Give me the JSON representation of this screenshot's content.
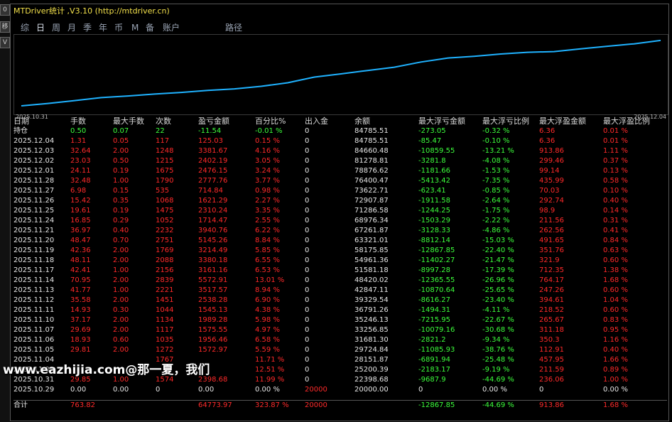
{
  "window": {
    "title": "MTDriver统计 ,V3.10 (http://mtdriver.cn)"
  },
  "left_strip": {
    "btn1": "0",
    "btn2": "移",
    "btn3": "V"
  },
  "tabs": [
    "综",
    "日",
    "周",
    "月",
    "季",
    "年",
    "币",
    "M",
    "备",
    "账户",
    "路径"
  ],
  "active_tab": "日",
  "chart": {
    "start_date": "2025.10.31",
    "end_date": "2025.12.04",
    "line_color": "#1fb2ff"
  },
  "chart_data": {
    "type": "line",
    "x": [
      "2025.10.31",
      "2025.11.03",
      "2025.11.04",
      "2025.11.05",
      "2025.11.06",
      "2025.11.07",
      "2025.11.10",
      "2025.11.11",
      "2025.11.12",
      "2025.11.13",
      "2025.11.14",
      "2025.11.17",
      "2025.11.18",
      "2025.11.19",
      "2025.11.20",
      "2025.11.21",
      "2025.11.24",
      "2025.11.25",
      "2025.11.26",
      "2025.11.27",
      "2025.11.28",
      "2025.12.01",
      "2025.12.02",
      "2025.12.03",
      "2025.12.04"
    ],
    "y": [
      20000,
      22398.68,
      25200.39,
      28151.87,
      29724.84,
      31681.3,
      33256.85,
      35246.13,
      36791.26,
      39329.54,
      42847.11,
      48420.02,
      51581.18,
      54961.36,
      58175.85,
      63321.01,
      67261.87,
      68976.34,
      71286.58,
      72907.87,
      73622.71,
      76400.47,
      78876.62,
      81278.81,
      84660.48
    ]
  },
  "headers": [
    "日期",
    "手数",
    "最大手数",
    "次数",
    "盈亏金额",
    "百分比%",
    "出入金",
    "余额",
    "最大浮亏金额",
    "最大浮亏比例",
    "最大浮盈金额",
    "最大浮盈比例"
  ],
  "holding": [
    "持仓",
    "0.50",
    "0.07",
    "22",
    "-11.54",
    "-0.01 %",
    "0",
    "84785.51",
    "-273.05",
    "-0.32 %",
    "6.36",
    "0.01 %"
  ],
  "rows": [
    [
      "2025.12.04",
      "1.31",
      "0.05",
      "117",
      "125.03",
      "0.15 %",
      "0",
      "84785.51",
      "-85.47",
      "-0.10 %",
      "6.36",
      "0.01 %"
    ],
    [
      "2025.12.03",
      "32.64",
      "2.00",
      "1248",
      "3381.67",
      "4.16 %",
      "0",
      "84660.48",
      "-10859.55",
      "-13.21 %",
      "913.86",
      "1.11 %"
    ],
    [
      "2025.12.02",
      "23.03",
      "0.50",
      "1215",
      "2402.19",
      "3.05 %",
      "0",
      "81278.81",
      "-3281.8",
      "-4.08 %",
      "299.46",
      "0.37 %"
    ],
    [
      "2025.12.01",
      "24.11",
      "0.19",
      "1675",
      "2476.15",
      "3.24 %",
      "0",
      "78876.62",
      "-1181.66",
      "-1.53 %",
      "99.14",
      "0.13 %"
    ],
    [
      "2025.11.28",
      "32.48",
      "1.00",
      "1790",
      "2777.76",
      "3.77 %",
      "0",
      "76400.47",
      "-5413.42",
      "-7.35 %",
      "435.99",
      "0.58 %"
    ],
    [
      "2025.11.27",
      "6.98",
      "0.15",
      "535",
      "714.84",
      "0.98 %",
      "0",
      "73622.71",
      "-623.41",
      "-0.85 %",
      "70.03",
      "0.10 %"
    ],
    [
      "2025.11.26",
      "15.42",
      "0.35",
      "1068",
      "1621.29",
      "2.27 %",
      "0",
      "72907.87",
      "-1911.58",
      "-2.64 %",
      "292.74",
      "0.40 %"
    ],
    [
      "2025.11.25",
      "19.61",
      "0.19",
      "1475",
      "2310.24",
      "3.35 %",
      "0",
      "71286.58",
      "-1244.25",
      "-1.75 %",
      "98.9",
      "0.14 %"
    ],
    [
      "2025.11.24",
      "16.85",
      "0.29",
      "1052",
      "1714.47",
      "2.55 %",
      "0",
      "68976.34",
      "-1503.29",
      "-2.22 %",
      "211.56",
      "0.31 %"
    ],
    [
      "2025.11.21",
      "36.97",
      "0.40",
      "2232",
      "3940.76",
      "6.22 %",
      "0",
      "67261.87",
      "-3128.33",
      "-4.86 %",
      "262.56",
      "0.41 %"
    ],
    [
      "2025.11.20",
      "48.47",
      "0.70",
      "2751",
      "5145.26",
      "8.84 %",
      "0",
      "63321.01",
      "-8812.14",
      "-15.03 %",
      "491.65",
      "0.84 %"
    ],
    [
      "2025.11.19",
      "42.36",
      "2.00",
      "1769",
      "3214.49",
      "5.85 %",
      "0",
      "58175.85",
      "-12867.85",
      "-22.40 %",
      "351.76",
      "0.63 %"
    ],
    [
      "2025.11.18",
      "48.11",
      "2.00",
      "2088",
      "3380.18",
      "6.55 %",
      "0",
      "54961.36",
      "-11402.27",
      "-21.47 %",
      "321.9",
      "0.60 %"
    ],
    [
      "2025.11.17",
      "42.41",
      "1.00",
      "2156",
      "3161.16",
      "6.53 %",
      "0",
      "51581.18",
      "-8997.28",
      "-17.39 %",
      "712.35",
      "1.38 %"
    ],
    [
      "2025.11.14",
      "70.95",
      "2.00",
      "2839",
      "5572.91",
      "13.01 %",
      "0",
      "48420.02",
      "-12365.55",
      "-26.96 %",
      "764.17",
      "1.68 %"
    ],
    [
      "2025.11.13",
      "41.77",
      "1.00",
      "2221",
      "3517.57",
      "8.94 %",
      "0",
      "42847.11",
      "-10870.64",
      "-25.65 %",
      "247.26",
      "0.60 %"
    ],
    [
      "2025.11.12",
      "35.58",
      "2.00",
      "1451",
      "2538.28",
      "6.90 %",
      "0",
      "39329.54",
      "-8616.27",
      "-23.40 %",
      "394.61",
      "1.04 %"
    ],
    [
      "2025.11.11",
      "14.93",
      "0.30",
      "1044",
      "1545.13",
      "4.38 %",
      "0",
      "36791.26",
      "-1494.31",
      "-4.11 %",
      "218.52",
      "0.60 %"
    ],
    [
      "2025.11.10",
      "37.17",
      "2.00",
      "1134",
      "1989.28",
      "5.98 %",
      "0",
      "35246.13",
      "-7215.95",
      "-22.67 %",
      "265.67",
      "0.83 %"
    ],
    [
      "2025.11.07",
      "29.69",
      "2.00",
      "1117",
      "1575.55",
      "4.97 %",
      "0",
      "33256.85",
      "-10079.16",
      "-30.68 %",
      "311.18",
      "0.95 %"
    ],
    [
      "2025.11.06",
      "18.93",
      "0.60",
      "1035",
      "1956.46",
      "6.58 %",
      "0",
      "31681.30",
      "-2821.2",
      "-9.34 %",
      "350.3",
      "1.16 %"
    ],
    [
      "2025.11.05",
      "29.81",
      "2.00",
      "1272",
      "1572.97",
      "5.59 %",
      "0",
      "29724.84",
      "-11085.93",
      "-38.76 %",
      "112.91",
      "0.40 %"
    ],
    [
      "2025.11.04",
      "",
      "",
      "1767",
      "",
      "11.71 %",
      "0",
      "28151.87",
      "-6891.94",
      "-25.48 %",
      "457.95",
      "1.66 %"
    ],
    [
      "2025.11.03",
      "",
      "",
      "",
      "",
      "12.51 %",
      "0",
      "25200.39",
      "-2183.17",
      "-9.19 %",
      "211.59",
      "0.89 %"
    ],
    [
      "2025.10.31",
      "29.85",
      "1.00",
      "1574",
      "2398.68",
      "11.99 %",
      "0",
      "22398.68",
      "-9687.9",
      "-44.69 %",
      "236.06",
      "1.00 %"
    ],
    [
      "2025.10.29",
      "0.00",
      "0.00",
      "0",
      "0.00",
      "0.00 %",
      "20000",
      "20000.00",
      "0",
      "0.00 %",
      "0",
      "0.00 %"
    ]
  ],
  "totals": [
    "合计",
    "763.82",
    "",
    "",
    "64773.97",
    "323.87 %",
    "20000",
    "",
    "-12867.85",
    "-44.69 %",
    "913.86",
    "1.68 %"
  ],
  "watermark": "www.eazhijia.com@那一夏，我们"
}
